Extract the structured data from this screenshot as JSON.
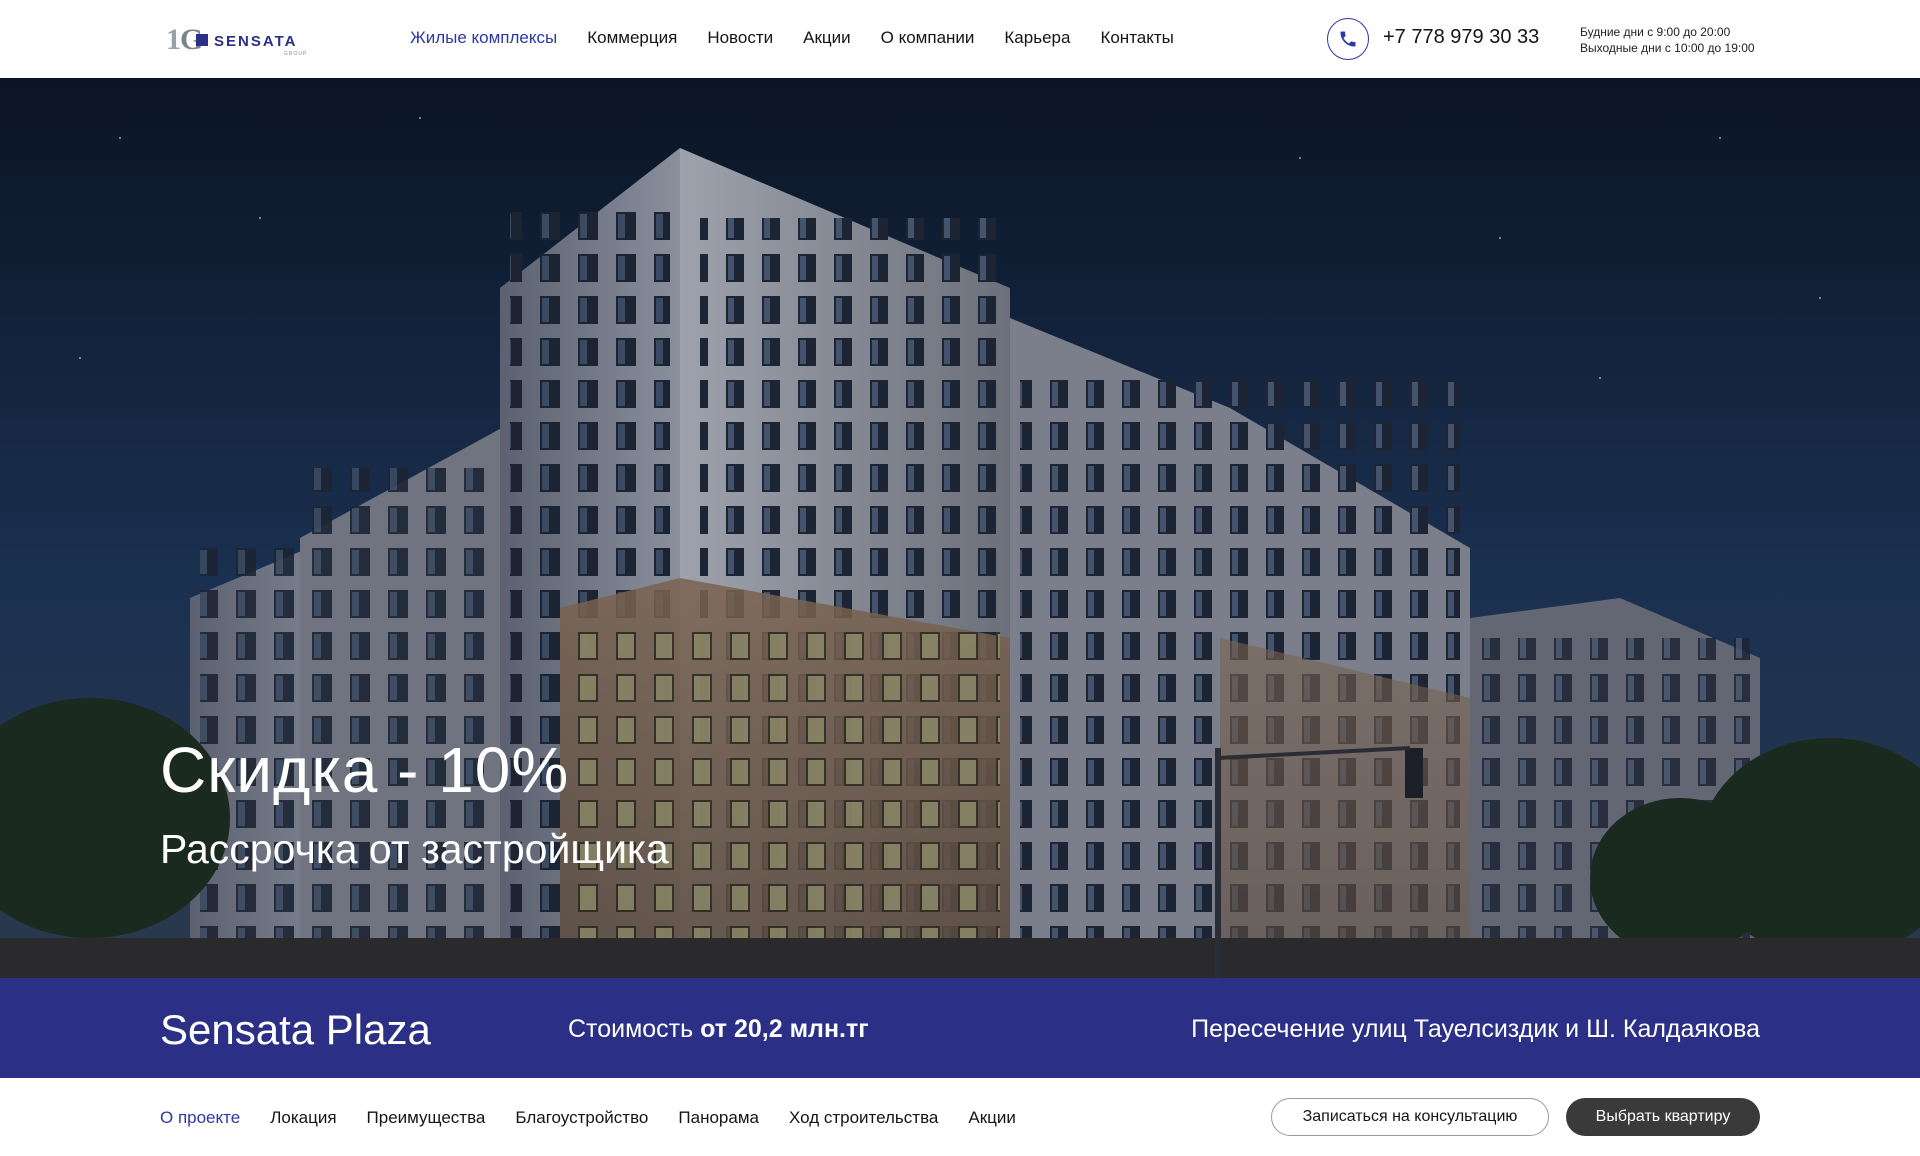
{
  "header": {
    "logo_text": "SENSATA",
    "logo_sub": "GROUP",
    "nav": [
      {
        "label": "Жилые комплексы",
        "active": true
      },
      {
        "label": "Коммерция",
        "active": false
      },
      {
        "label": "Новости",
        "active": false
      },
      {
        "label": "Акции",
        "active": false
      },
      {
        "label": "О компании",
        "active": false
      },
      {
        "label": "Карьера",
        "active": false
      },
      {
        "label": "Контакты",
        "active": false
      }
    ],
    "phone_icon": "phone-icon",
    "phone": "+7 778 979 30 33",
    "hours_weekdays": "Будние дни с 9:00 до 20:00",
    "hours_weekend": "Выходные дни с 10:00 до 19:00"
  },
  "hero": {
    "title": "Скидка - 10%",
    "subtitle": "Рассрочка от застройщика"
  },
  "project": {
    "name": "Sensata Plaza",
    "price_prefix": "Стоимость",
    "price_value": "от 20,2 млн.тг",
    "address": "Пересечение улиц Тауелсиздик и Ш. Калдаякова"
  },
  "subnav": {
    "links": [
      {
        "label": "О проекте",
        "active": true
      },
      {
        "label": "Локация",
        "active": false
      },
      {
        "label": "Преимущества",
        "active": false
      },
      {
        "label": "Благоустройство",
        "active": false
      },
      {
        "label": "Панорама",
        "active": false
      },
      {
        "label": "Ход строительства",
        "active": false
      },
      {
        "label": "Акции",
        "active": false
      }
    ],
    "consult_button": "Записаться на консультацию",
    "choose_button": "Выбрать квартиру"
  },
  "colors": {
    "brand": "#2b2f86",
    "accent": "#2c37a8",
    "dark_button": "#3a3a3a"
  }
}
